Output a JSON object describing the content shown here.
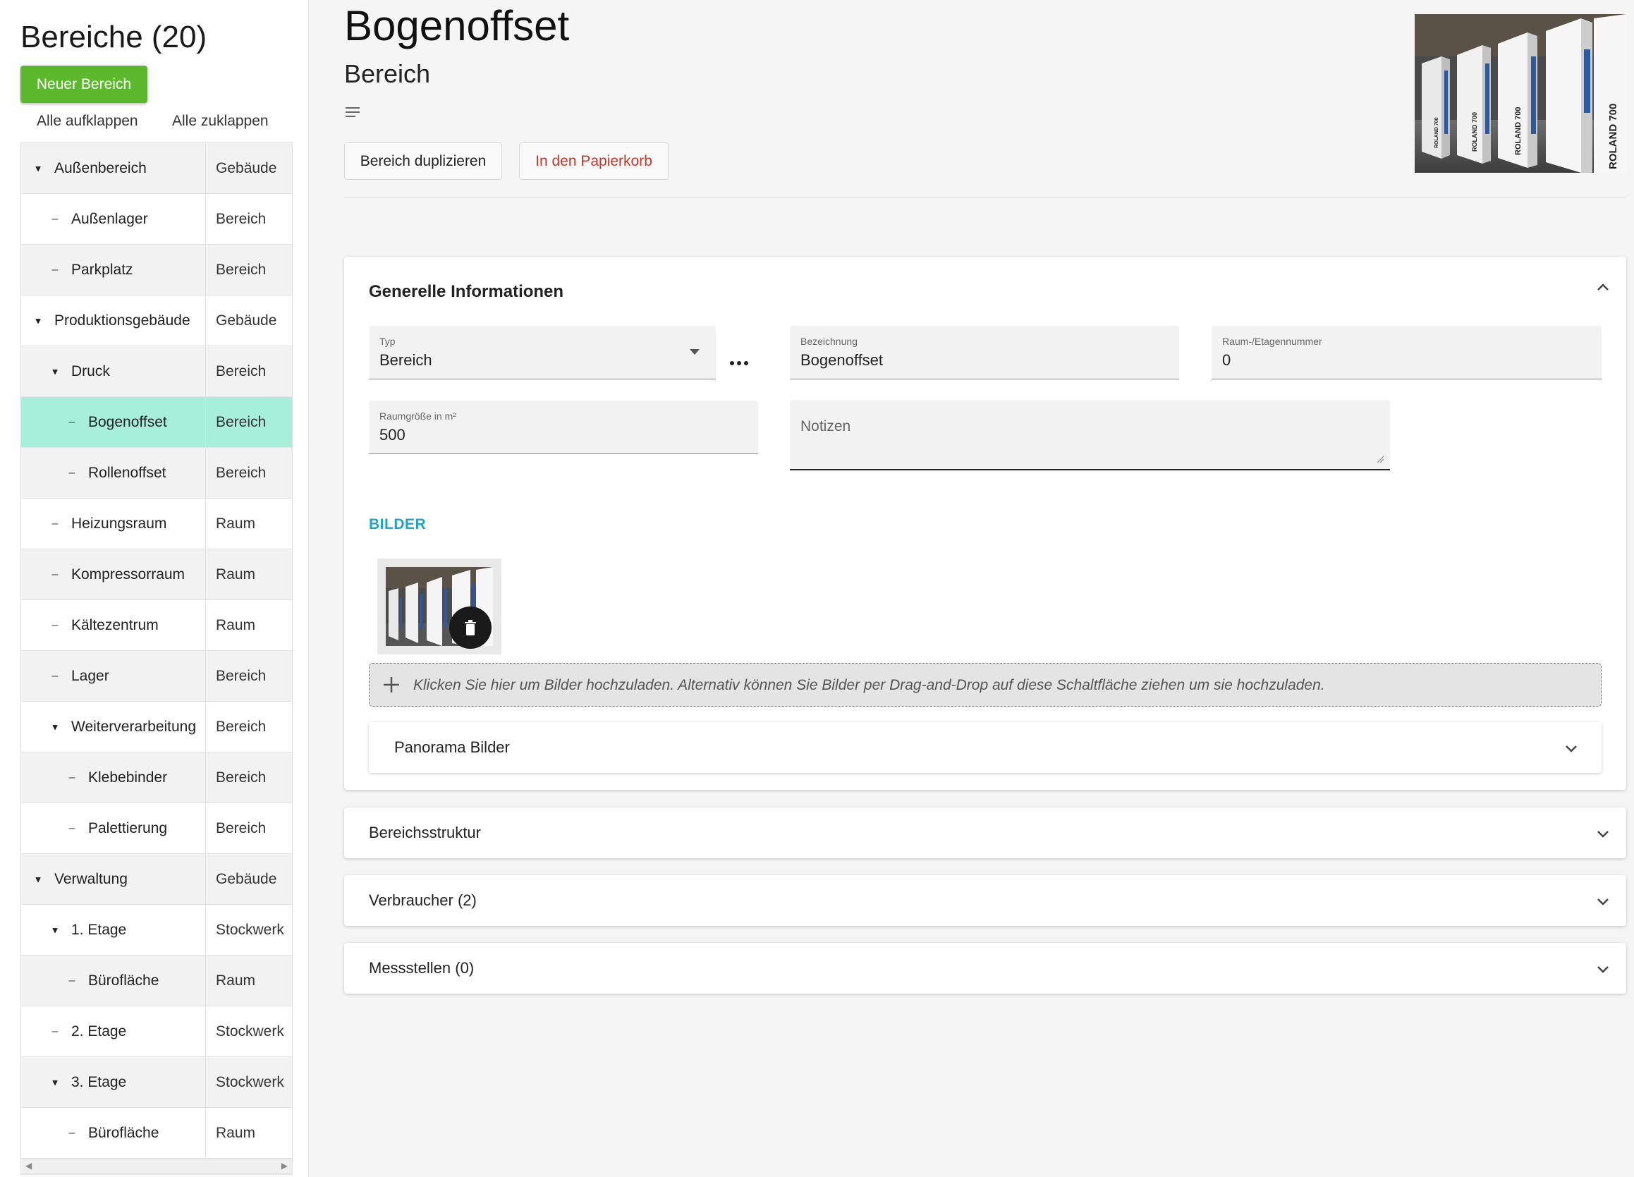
{
  "sidebar": {
    "title": "Bereiche (20)",
    "new_button": "Neuer Bereich",
    "expand_all": "Alle aufklappen",
    "collapse_all": "Alle zuklappen",
    "tree": [
      {
        "label": "Außenbereich",
        "type": "Gebäude",
        "level": 0,
        "marker": "expanded"
      },
      {
        "label": "Außenlager",
        "type": "Bereich",
        "level": 1,
        "marker": "leaf"
      },
      {
        "label": "Parkplatz",
        "type": "Bereich",
        "level": 1,
        "marker": "leaf"
      },
      {
        "label": "Produktionsgebäude",
        "type": "Gebäude",
        "level": 0,
        "marker": "expanded"
      },
      {
        "label": "Druck",
        "type": "Bereich",
        "level": 1,
        "marker": "expanded"
      },
      {
        "label": "Bogenoffset",
        "type": "Bereich",
        "level": 2,
        "marker": "leaf",
        "selected": true
      },
      {
        "label": "Rollenoffset",
        "type": "Bereich",
        "level": 2,
        "marker": "leaf"
      },
      {
        "label": "Heizungsraum",
        "type": "Raum",
        "level": 1,
        "marker": "leaf"
      },
      {
        "label": "Kompressorraum",
        "type": "Raum",
        "level": 1,
        "marker": "leaf"
      },
      {
        "label": "Kältezentrum",
        "type": "Raum",
        "level": 1,
        "marker": "leaf"
      },
      {
        "label": "Lager",
        "type": "Bereich",
        "level": 1,
        "marker": "leaf"
      },
      {
        "label": "Weiterverarbeitung",
        "type": "Bereich",
        "level": 1,
        "marker": "expanded"
      },
      {
        "label": "Klebebinder",
        "type": "Bereich",
        "level": 2,
        "marker": "leaf"
      },
      {
        "label": "Palettierung",
        "type": "Bereich",
        "level": 2,
        "marker": "leaf"
      },
      {
        "label": "Verwaltung",
        "type": "Gebäude",
        "level": 0,
        "marker": "expanded"
      },
      {
        "label": "1. Etage",
        "type": "Stockwerk",
        "level": 1,
        "marker": "expanded"
      },
      {
        "label": "Bürofläche",
        "type": "Raum",
        "level": 2,
        "marker": "leaf"
      },
      {
        "label": "2. Etage",
        "type": "Stockwerk",
        "level": 1,
        "marker": "leaf"
      },
      {
        "label": "3. Etage",
        "type": "Stockwerk",
        "level": 1,
        "marker": "expanded"
      },
      {
        "label": "Bürofläche",
        "type": "Raum",
        "level": 2,
        "marker": "leaf"
      }
    ]
  },
  "header": {
    "title": "Bogenoffset",
    "subtitle": "Bereich",
    "duplicate_button": "Bereich duplizieren",
    "trash_button": "In den Papierkorb",
    "image_labels": [
      "ROLAND 700",
      "ROLAND 700",
      "ROLAND 700",
      "ROLAND 700"
    ]
  },
  "general": {
    "title": "Generelle Informationen",
    "typ": {
      "label": "Typ",
      "value": "Bereich"
    },
    "bezeichnung": {
      "label": "Bezeichnung",
      "value": "Bogenoffset"
    },
    "raumnummer": {
      "label": "Raum-/Etagennummer",
      "value": "0"
    },
    "raumgroesse": {
      "label": "Raumgröße in m²",
      "value": "500"
    },
    "notizen": {
      "label": "Notizen"
    },
    "bilder_title": "BILDER",
    "upload_text": "Klicken Sie hier um Bilder hochzuladen. Alternativ können Sie Bilder per Drag-and-Drop auf diese Schaltfläche ziehen um sie hochzuladen.",
    "panorama_title": "Panorama Bilder"
  },
  "accordions": {
    "bereichsstruktur": "Bereichsstruktur",
    "verbraucher": "Verbraucher (2)",
    "messstellen": "Messstellen (0)"
  },
  "colors": {
    "accent_green": "#5cb82d",
    "selected_row": "#a6f0d9",
    "danger": "#c0392b",
    "section_heading": "#1fa3c9"
  }
}
